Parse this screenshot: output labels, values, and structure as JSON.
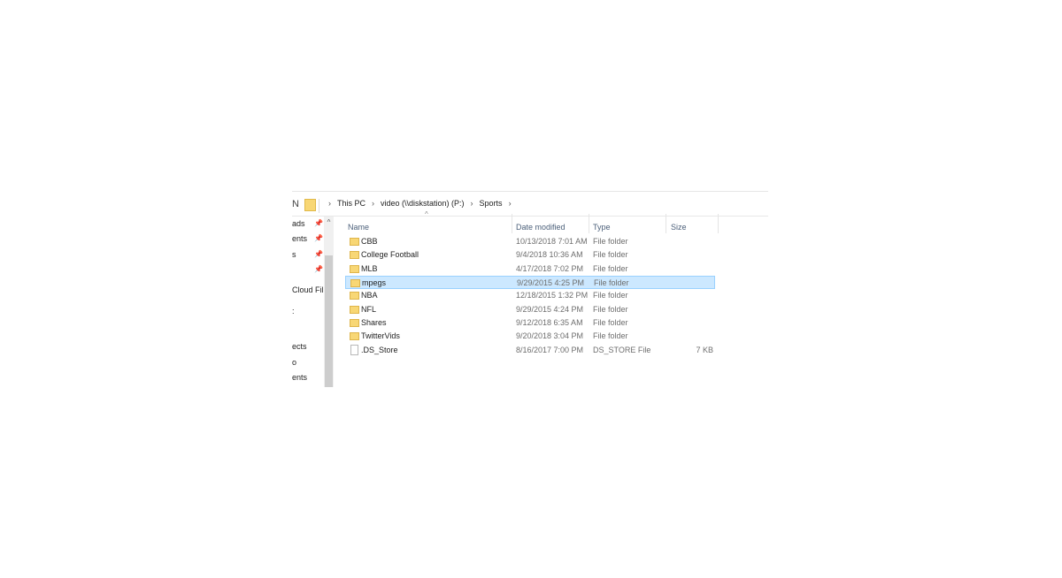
{
  "address": {
    "edge_glyph": "N",
    "crumbs": [
      "This PC",
      "video (\\\\diskstation) (P:)",
      "Sports"
    ]
  },
  "nav": {
    "items": [
      {
        "label": "ads",
        "pinned": true
      },
      {
        "label": "ents",
        "pinned": true
      },
      {
        "label": "s",
        "pinned": true
      },
      {
        "label": "",
        "pinned": true
      },
      {
        "label": "Cloud Fil",
        "pinned": false
      },
      {
        "label": ":",
        "pinned": false
      },
      {
        "label": "ects",
        "pinned": false
      },
      {
        "label": "o",
        "pinned": false
      },
      {
        "label": "ents",
        "pinned": false
      }
    ],
    "pin_glyph": "📌",
    "scroll_up": "^"
  },
  "columns": {
    "name": "Name",
    "date": "Date modified",
    "type": "Type",
    "size": "Size",
    "sort_glyph": "^"
  },
  "rows": [
    {
      "name": "CBB",
      "date": "10/13/2018 7:01 AM",
      "type": "File folder",
      "size": "",
      "icon": "folder-icon",
      "selected": false
    },
    {
      "name": "College Football",
      "date": "9/4/2018 10:36 AM",
      "type": "File folder",
      "size": "",
      "icon": "folder-icon",
      "selected": false
    },
    {
      "name": "MLB",
      "date": "4/17/2018 7:02 PM",
      "type": "File folder",
      "size": "",
      "icon": "folder-icon",
      "selected": false
    },
    {
      "name": "mpegs",
      "date": "9/29/2015 4:25 PM",
      "type": "File folder",
      "size": "",
      "icon": "folder-icon",
      "selected": true
    },
    {
      "name": "NBA",
      "date": "12/18/2015 1:32 PM",
      "type": "File folder",
      "size": "",
      "icon": "folder-icon",
      "selected": false
    },
    {
      "name": "NFL",
      "date": "9/29/2015 4:24 PM",
      "type": "File folder",
      "size": "",
      "icon": "folder-icon",
      "selected": false
    },
    {
      "name": "Shares",
      "date": "9/12/2018 6:35 AM",
      "type": "File folder",
      "size": "",
      "icon": "folder-icon",
      "selected": false
    },
    {
      "name": "TwitterVids",
      "date": "9/20/2018 3:04 PM",
      "type": "File folder",
      "size": "",
      "icon": "folder-icon",
      "selected": false
    },
    {
      "name": ".DS_Store",
      "date": "8/16/2017 7:00 PM",
      "type": "DS_STORE File",
      "size": "7 KB",
      "icon": "file-icon",
      "selected": false
    }
  ],
  "colors": {
    "folder": "#f8d775",
    "selection": "#cce8ff",
    "selection_border": "#99d1ff",
    "header_text": "#4c607a"
  }
}
